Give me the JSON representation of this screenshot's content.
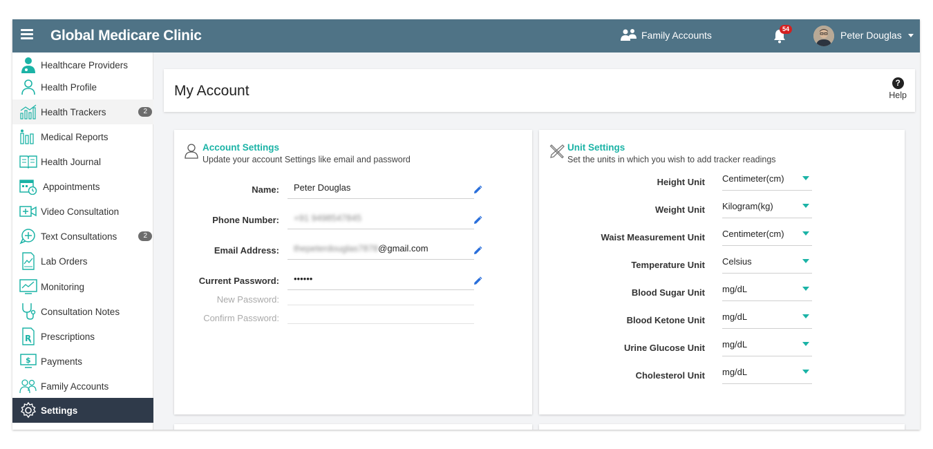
{
  "header": {
    "app_title": "Global Medicare Clinic",
    "family_accounts_label": "Family Accounts",
    "notification_count": "54",
    "user_name": "Peter Douglas"
  },
  "sidebar": {
    "items": [
      {
        "label": "Healthcare Providers",
        "icon": "doctor-icon"
      },
      {
        "label": "Health Profile",
        "icon": "person-icon"
      },
      {
        "label": "Health Trackers",
        "icon": "chart-icon",
        "count": "2"
      },
      {
        "label": "Medical Reports",
        "icon": "reports-icon"
      },
      {
        "label": "Health Journal",
        "icon": "journal-icon"
      },
      {
        "label": "Appointments",
        "icon": "calendar-icon"
      },
      {
        "label": "Video Consultation",
        "icon": "video-icon"
      },
      {
        "label": "Text Consultations",
        "icon": "chat-plus-icon",
        "count": "2"
      },
      {
        "label": "Lab Orders",
        "icon": "lab-icon"
      },
      {
        "label": "Monitoring",
        "icon": "monitor-icon"
      },
      {
        "label": "Consultation Notes",
        "icon": "stethoscope-icon"
      },
      {
        "label": "Prescriptions",
        "icon": "rx-icon"
      },
      {
        "label": "Payments",
        "icon": "payment-icon"
      },
      {
        "label": "Family Accounts",
        "icon": "family-icon"
      },
      {
        "label": "Settings",
        "icon": "gear-icon"
      }
    ]
  },
  "page": {
    "title": "My Account",
    "help_label": "Help"
  },
  "account_settings": {
    "title": "Account Settings",
    "subtitle": "Update your account Settings like email and password",
    "name_label": "Name:",
    "name_value": "Peter Douglas",
    "phone_label": "Phone Number:",
    "phone_value": "+91 9498547845",
    "email_label": "Email Address:",
    "email_hidden": "thepeterdouglas7878",
    "email_domain": "@gmail.com",
    "current_password_label": "Current Password:",
    "current_password_value": "••••••",
    "new_password_label": "New Password:",
    "confirm_password_label": "Confirm Password:"
  },
  "unit_settings": {
    "title": "Unit Settings",
    "subtitle": "Set the units in which you wish to add tracker readings",
    "rows": [
      {
        "label": "Height Unit",
        "value": "Centimeter(cm)"
      },
      {
        "label": "Weight Unit",
        "value": "Kilogram(kg)"
      },
      {
        "label": "Waist Measurement Unit",
        "value": "Centimeter(cm)"
      },
      {
        "label": "Temperature Unit",
        "value": "Celsius"
      },
      {
        "label": "Blood Sugar Unit",
        "value": "mg/dL"
      },
      {
        "label": "Blood Ketone Unit",
        "value": "mg/dL"
      },
      {
        "label": "Urine Glucose Unit",
        "value": "mg/dL"
      },
      {
        "label": "Cholesterol Unit",
        "value": "mg/dL"
      }
    ]
  },
  "colors": {
    "topbar": "#4f7386",
    "accent": "#1bb3a6",
    "active_sidebar": "#2f3a4a",
    "badge": "#d42020"
  }
}
